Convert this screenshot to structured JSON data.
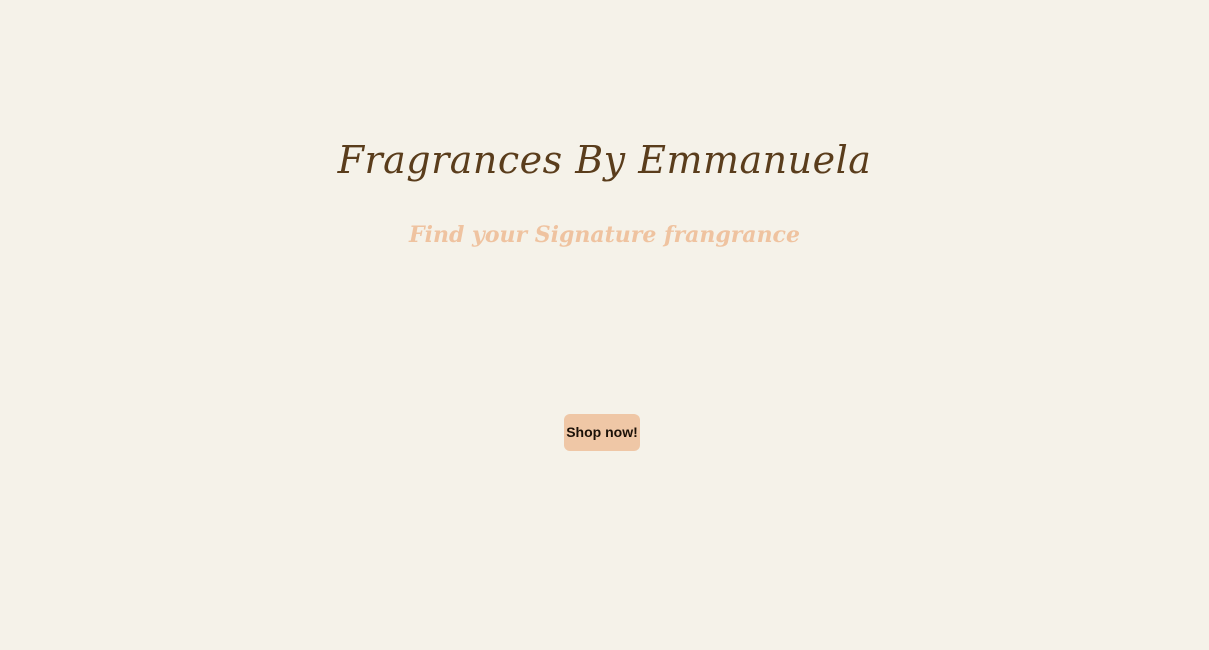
{
  "hero": {
    "title": "Fragrances By Emmanuela",
    "tagline": "Find your Signature frangrance",
    "cta_label": "Shop now!"
  },
  "colors": {
    "background": "#f5f2e9",
    "title": "#5a3d1c",
    "tagline": "#efc3a0",
    "button_bg": "#efc7a6",
    "button_text": "#1b1108"
  }
}
